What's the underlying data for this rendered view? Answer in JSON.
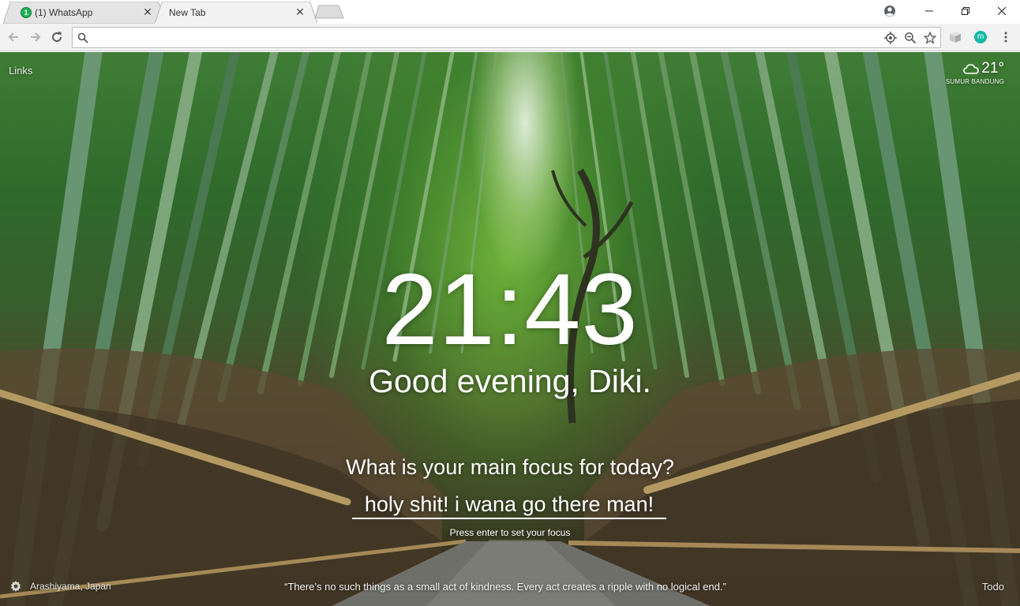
{
  "tabs": [
    {
      "title": "(1) WhatsApp",
      "badge": "1",
      "active": false
    },
    {
      "title": "New Tab",
      "active": true
    }
  ],
  "omnibox": {
    "value": "",
    "placeholder": ""
  },
  "extensions": {
    "momentum_badge": "m"
  },
  "momentum": {
    "links_label": "Links",
    "weather": {
      "temperature": "21°",
      "location": "SUMUR BANDUNG",
      "icon": "cloud-icon"
    },
    "clock": "21:43",
    "greeting": "Good evening, Diki.",
    "focus_question": "What is your main focus for today?",
    "focus_value": "holy shit! i wana go there man!",
    "focus_hint": "Press enter to set your focus",
    "photo_location": "Arashiyama, Japan",
    "quote": "“There’s no such things as a small act of kindness. Every act creates a ripple with no logical end.”",
    "todo_label": "Todo"
  },
  "colors": {
    "toolbar": "#f2f2f2",
    "whatsapp_green": "#1fb355",
    "momentum_teal": "#15b8a6"
  }
}
